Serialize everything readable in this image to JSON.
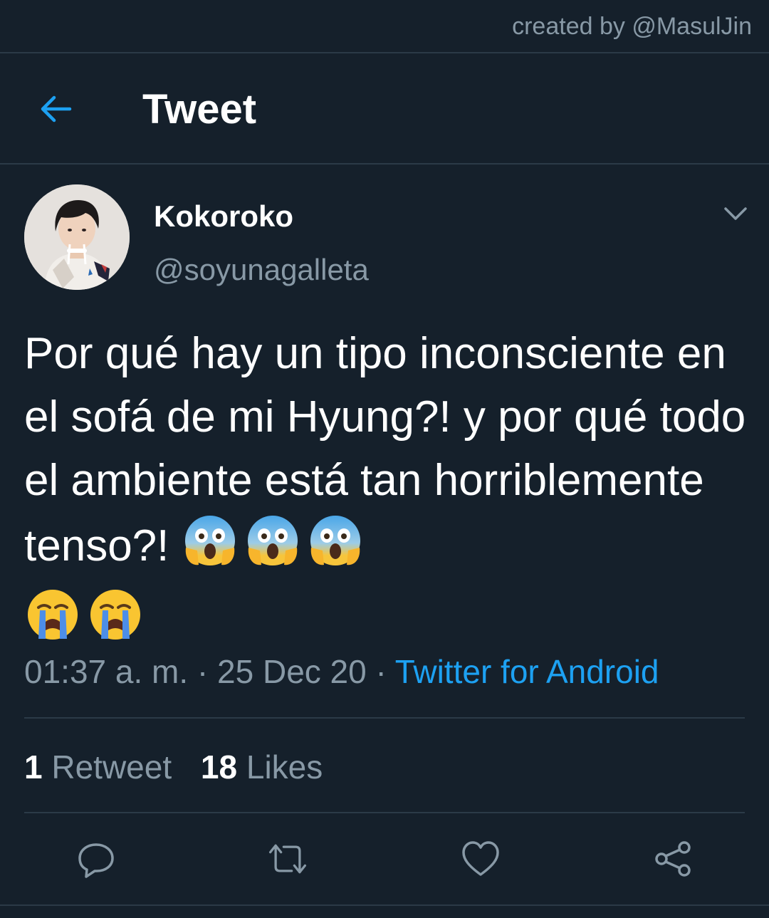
{
  "watermark": "created by @MasulJin",
  "header": {
    "title": "Tweet",
    "back_icon": "back-arrow-icon"
  },
  "author": {
    "display_name": "Kokoroko",
    "handle": "@soyunagalleta"
  },
  "tweet": {
    "text": "Por qué hay un tipo inconsciente en el sofá de mi Hyung?! y por qué todo el ambiente está tan horriblemente tenso?!",
    "emojis": [
      "face-screaming-in-fear",
      "face-screaming-in-fear",
      "face-screaming-in-fear",
      "loudly-crying-face",
      "loudly-crying-face"
    ],
    "time": "01:37 a. m.",
    "sep1": " · ",
    "date": "25 Dec 20",
    "sep2": " · ",
    "source": "Twitter for Android"
  },
  "stats": {
    "retweets_count": "1",
    "retweets_label": "Retweet",
    "likes_count": "18",
    "likes_label": "Likes"
  },
  "colors": {
    "background": "#15202b",
    "divider": "#2b3a47",
    "accent": "#1da1f2",
    "secondary_text": "#8899a6"
  }
}
